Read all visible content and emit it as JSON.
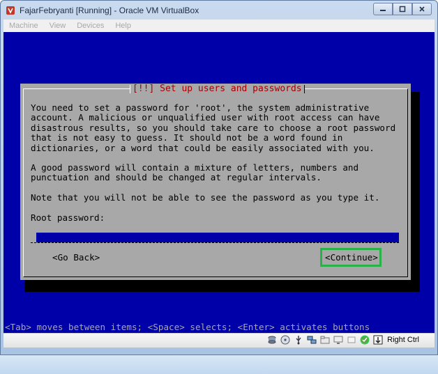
{
  "window": {
    "title": "FajarFebryanti [Running] - Oracle VM VirtualBox",
    "controls": {
      "minimize": "▭",
      "maximize": "▣",
      "close": "✕"
    }
  },
  "menubar": {
    "items": [
      {
        "label": "Machine"
      },
      {
        "label": "View"
      },
      {
        "label": "Devices"
      },
      {
        "label": "Help"
      }
    ]
  },
  "dialog": {
    "title": "[!!] Set up users and passwords",
    "paragraph1": "You need to set a password for 'root', the system administrative\naccount. A malicious or unqualified user with root access can have\ndisastrous results, so you should take care to choose a root password\nthat is not easy to guess. It should not be a word found in\ndictionaries, or a word that could be easily associated with you.",
    "paragraph2": "A good password will contain a mixture of letters, numbers and\npunctuation and should be changed at regular intervals.",
    "paragraph3": "Note that you will not be able to see the password as you type it.",
    "field_label": "Root password:",
    "field_value": "",
    "go_back_label": "<Go Back>",
    "continue_label": "<Continue>"
  },
  "help_line": "<Tab> moves between items; <Space> selects; <Enter> activates buttons",
  "statusbar": {
    "icons": [
      "hard-disk-icon",
      "optical-drive-icon",
      "usb-icon",
      "network-icon",
      "shared-folders-icon",
      "display-icon",
      "video-capture-icon",
      "virtualization-icon",
      "mouse-integration-icon"
    ],
    "host_key": "Right Ctrl"
  },
  "colors": {
    "vm_background": "#0000a8",
    "dialog_background": "#a8a8a8",
    "title_red": "#a80000",
    "highlight_green": "#29b14a"
  }
}
